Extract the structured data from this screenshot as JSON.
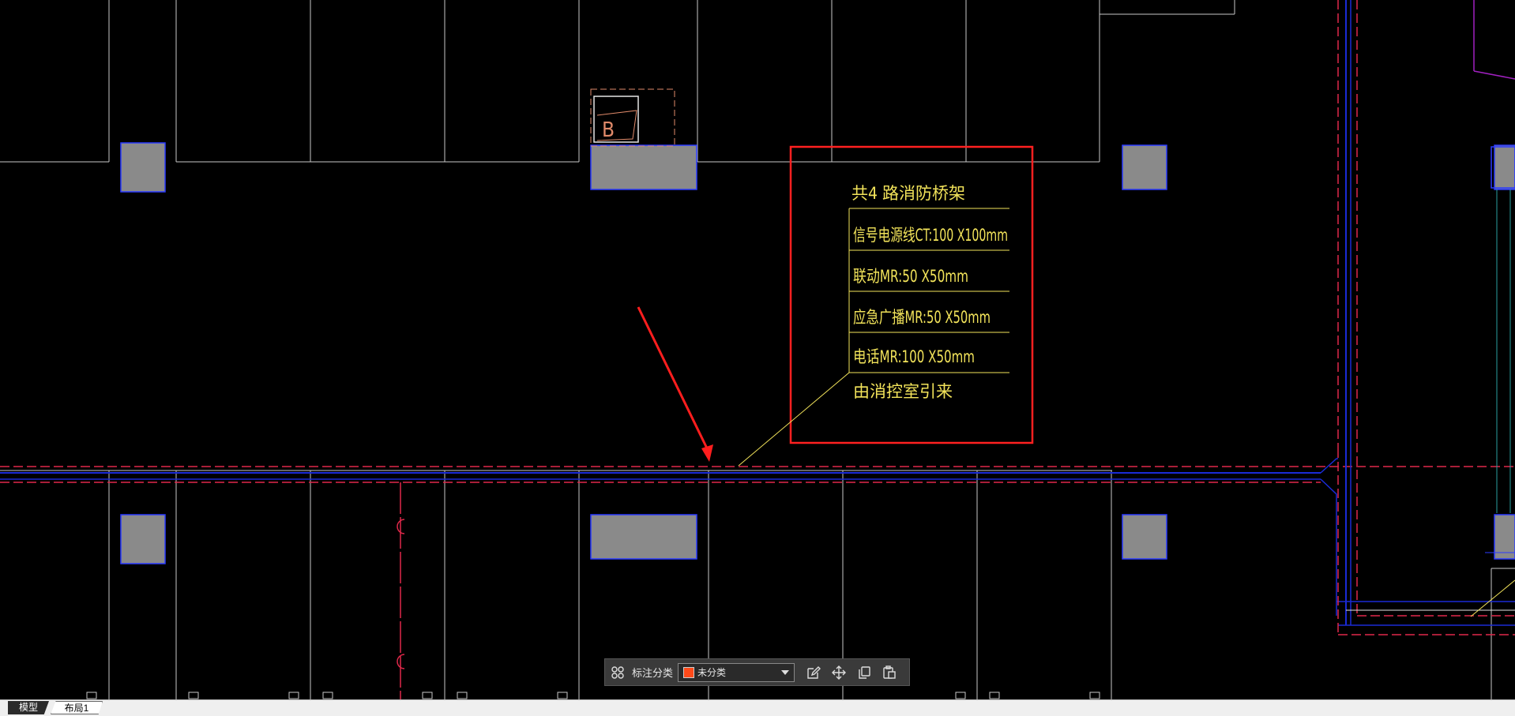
{
  "colors": {
    "background": "#000000",
    "wall_lines": "#c8c8c8",
    "column_fill": "#8a8a8a",
    "column_border": "#2b3bff",
    "annotation_text": "#f2e35a",
    "annotation_box": "#ff2020",
    "arrow": "#ff1e1e",
    "dashed_line": "#e0284a",
    "blue_line": "#1a2bd6",
    "category_swatch": "#ff4a1a"
  },
  "drawing": {
    "tag_label": "B",
    "callout": {
      "title": "共4 路消防桥架",
      "rows": [
        "信号电源线CT:100 X100mm",
        "联动MR:50 X50mm",
        "应急广播MR:50 X50mm",
        "电话MR:100 X50mm"
      ],
      "footer": "由消控室引来"
    }
  },
  "toolbar": {
    "label": "标注分类",
    "category_value": "未分类",
    "icons": [
      "grid-icon",
      "edit-icon",
      "move-icon",
      "copy-icon",
      "paste-icon"
    ]
  },
  "tabs": {
    "model": "模型",
    "layout1": "布局1"
  }
}
